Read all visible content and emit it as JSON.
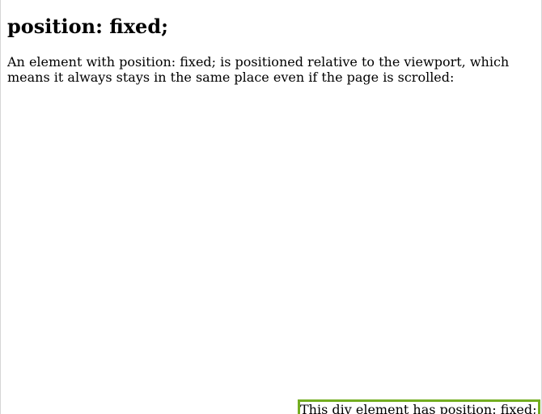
{
  "page": {
    "heading": "position: fixed;",
    "description": "An element with position: fixed; is positioned relative to the viewport, which means it always stays in the same place even if the page is scrolled:",
    "fixed_box_text": "This div element has position: fixed;"
  },
  "colors": {
    "fixed_box_border": "#73AD21",
    "background": "#ffffff",
    "text": "#000000"
  }
}
